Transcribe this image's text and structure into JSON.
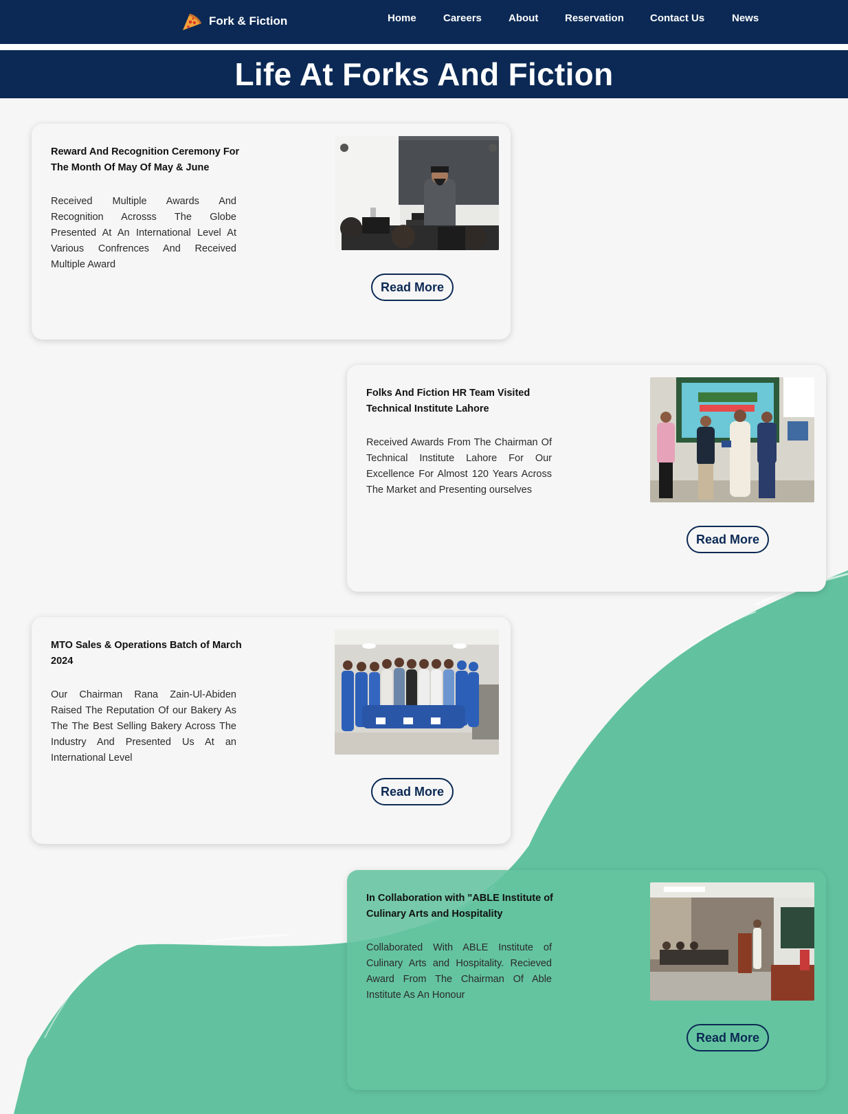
{
  "header": {
    "brand_name": "Fork & Fiction",
    "logo_icon": "pizza-slice-icon",
    "nav": [
      "Home",
      "Careers",
      "About",
      "Reservation",
      "Contact Us",
      "News"
    ],
    "background_color": "#0b2954"
  },
  "page_title": "Life At Forks And Fiction",
  "accent_colors": {
    "navy": "#0b2954",
    "green": "#5fc19c",
    "background": "#f6f6f6"
  },
  "cards": [
    {
      "title": "Reward And Recognition Ceremony For The Month Of May Of May & June",
      "text": "Received Multiple Awards And Recognition Acrosss The Globe Presented At An International Level At Various Confrences And Received Multiple Award",
      "button": "Read More",
      "image": "photo of a presenter at a lecture podium in front of seated audience"
    },
    {
      "title": "Folks And Fiction HR Team Visited Technical Institute Lahore",
      "text": "Received Awards From The Chairman Of Technical Institute Lahore For Our Excellence For Almost 120 Years Across The Market and Presenting ourselves",
      "button": "Read More",
      "image": "photo of five men standing in front of a Cakes & Bakes banner"
    },
    {
      "title": "MTO Sales & Operations Batch of March 2024",
      "text": "Our Chairman Rana Zain-Ul-Abiden Raised The Reputation Of our Bakery As The The Best Selling Bakery Across The Industry And Presented Us At an International Level",
      "button": "Read More",
      "image": "group photo of staff in blue uniforms holding certificates"
    },
    {
      "title": "In Collaboration with \"ABLE Institute of Culinary Arts and Hospitality",
      "text": "Collaborated With ABLE Institute of Culinary Arts and Hospitality. Recieved Award From The Chairman Of Able Institute As An Honour",
      "button": "Read More",
      "image": "photo of a classroom with a speaker at a podium"
    }
  ]
}
